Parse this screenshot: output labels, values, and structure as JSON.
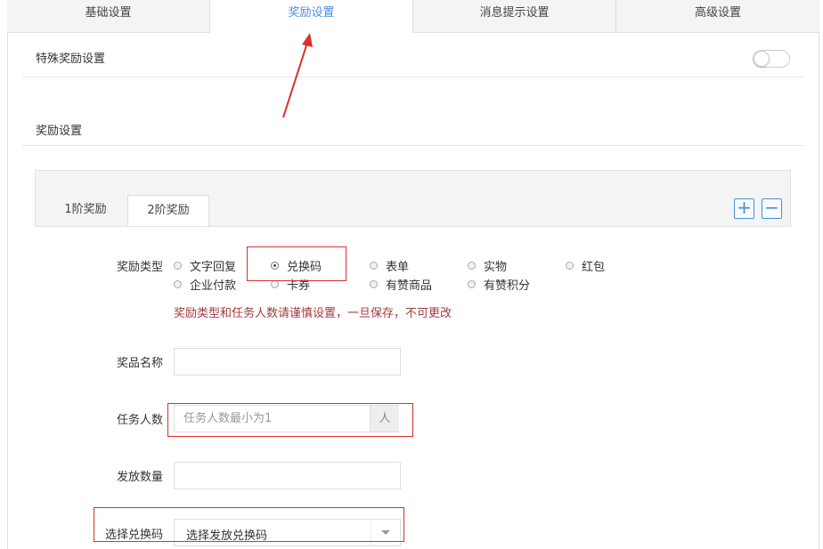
{
  "top_tabs": [
    {
      "label": "基础设置",
      "active": false
    },
    {
      "label": "奖励设置",
      "active": true
    },
    {
      "label": "消息提示设置",
      "active": false
    },
    {
      "label": "高级设置",
      "active": false
    }
  ],
  "special_reward": {
    "label": "特殊奖励设置",
    "enabled": false
  },
  "reward_settings_label": "奖励设置",
  "level_tabs": [
    {
      "label": "1阶奖励",
      "active": false
    },
    {
      "label": "2阶奖励",
      "active": true
    }
  ],
  "panel_buttons": {
    "add": "+",
    "remove": "−"
  },
  "form": {
    "reward_type_label": "奖励类型",
    "reward_types": [
      {
        "label": "文字回复",
        "checked": false
      },
      {
        "label": "兑换码",
        "checked": true
      },
      {
        "label": "表单",
        "checked": false
      },
      {
        "label": "实物",
        "checked": false
      },
      {
        "label": "红包",
        "checked": false
      },
      {
        "label": "企业付款",
        "checked": false
      },
      {
        "label": "卡券",
        "checked": false
      },
      {
        "label": "有赞商品",
        "checked": false
      },
      {
        "label": "有赞积分",
        "checked": false
      }
    ],
    "warning": "奖励类型和任务人数请谨慎设置，一旦保存，不可更改",
    "prize_name_label": "奖品名称",
    "prize_name_value": "",
    "task_count_label": "任务人数",
    "task_count_placeholder": "任务人数最小为1",
    "task_count_unit": "人",
    "issue_qty_label": "发放数量",
    "issue_qty_value": "",
    "select_code_label": "选择兑换码",
    "select_code_value": "选择发放兑换码"
  },
  "colors": {
    "accent": "#4a8fd8",
    "highlight": "#d9302c",
    "warning": "#a23a3a"
  }
}
